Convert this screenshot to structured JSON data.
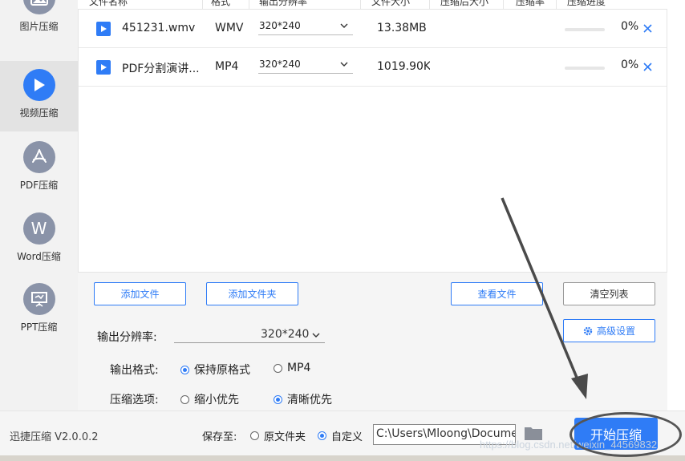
{
  "sidebar": {
    "items": [
      {
        "label": "图片压缩",
        "icon": "image-icon",
        "active": false
      },
      {
        "label": "视频压缩",
        "icon": "video-play-icon",
        "active": true
      },
      {
        "label": "PDF压缩",
        "icon": "pdf-icon",
        "active": false
      },
      {
        "label": "Word压缩",
        "icon": "word-icon",
        "active": false,
        "letter": "W"
      },
      {
        "label": "PPT压缩",
        "icon": "ppt-icon",
        "active": false
      }
    ]
  },
  "table": {
    "headers": [
      "文件名称",
      "格式",
      "输出分辨率",
      "文件大小",
      "压缩后大小",
      "压缩率",
      "压缩进度"
    ],
    "rows": [
      {
        "name": "451231.wmv",
        "format": "WMV",
        "resolution": "320*240",
        "size": "13.38MB",
        "progress": "0%"
      },
      {
        "name": "PDF分割演讲...",
        "format": "MP4",
        "resolution": "320*240",
        "size": "1019.90KB",
        "progress": "0%"
      }
    ]
  },
  "buttons": {
    "add_file": "添加文件",
    "add_folder": "添加文件夹",
    "view_file": "查看文件",
    "clear_list": "清空列表",
    "advanced": "高级设置"
  },
  "settings": {
    "resolution_label": "输出分辨率:",
    "resolution_value": "320*240",
    "format_label": "输出格式:",
    "format_options": [
      "保持原格式",
      "MP4"
    ],
    "compress_label": "压缩选项:",
    "compress_options": [
      "缩小优先",
      "清晰优先"
    ]
  },
  "footer": {
    "version": "迅捷压缩 V2.0.0.2",
    "save_label": "保存至:",
    "save_options": [
      "原文件夹",
      "自定义"
    ],
    "path": "C:\\Users\\Mloong\\Documents",
    "start": "开始压缩",
    "watermark": "https://blog.csdn.net/weixin_44569832"
  },
  "colors": {
    "accent": "#2f7cf6",
    "sidebar_bg": "#f2f2f2",
    "panel_bg": "#f5f5f5"
  }
}
